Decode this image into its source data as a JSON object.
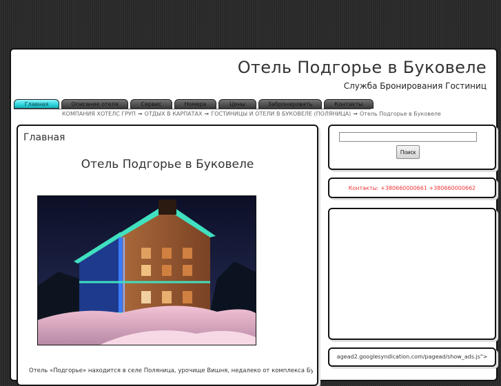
{
  "header": {
    "title": "Отель Подгорье в Буковеле",
    "subtitle": "Служба Бронирования Гостиниц"
  },
  "nav": {
    "tabs": [
      {
        "label": "Главная",
        "active": true
      },
      {
        "label": "Описание отеля",
        "active": false
      },
      {
        "label": "Сервис",
        "active": false
      },
      {
        "label": "Номера",
        "active": false
      },
      {
        "label": "Цены",
        "active": false
      },
      {
        "label": "Забронировать",
        "active": false
      },
      {
        "label": "Контакты",
        "active": false
      }
    ],
    "active_color": "#2bd4dc"
  },
  "breadcrumb": {
    "items": [
      "КОМПАНИЯ ХОТЕЛС ГРУП",
      "ОТДЫХ В КАРПАТАХ",
      "ГОСТИНИЦЫ И ОТЕЛИ В БУКОВЕЛЕ (ПОЛЯНИЦА)",
      "Отель Подгорье в Буковеле"
    ],
    "separator": "➞"
  },
  "main": {
    "heading": "Главная",
    "title": "Отель Подгорье в Буковеле",
    "photo_icon": "hotel-photo",
    "text": "Отель «Подгорье» находится в селе Поляница, урочище Вишня, недалеко от комплекса Буковель, в"
  },
  "sidebar": {
    "search_value": "",
    "search_button": "Поиск",
    "contacts": "Контакты: +380660000661 +380660000662",
    "contacts_color": "#e33333",
    "script_text": "agead2.googlesyndication.com/pagead/show_ads.js\">"
  }
}
